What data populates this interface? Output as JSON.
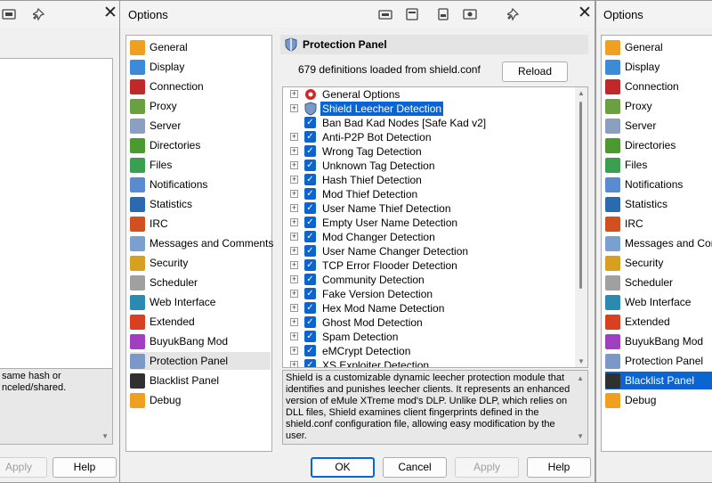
{
  "left_window": {
    "desc_lines": [
      "same hash or",
      "nceled/shared."
    ],
    "apply_label": "Apply",
    "help_label": "Help"
  },
  "main_window": {
    "title": "Options",
    "nav_items": [
      {
        "label": "General",
        "icon": "general-icon",
        "color": "#f0a020"
      },
      {
        "label": "Display",
        "icon": "display-icon",
        "color": "#3c8ad8"
      },
      {
        "label": "Connection",
        "icon": "connection-icon",
        "color": "#c0282a"
      },
      {
        "label": "Proxy",
        "icon": "proxy-icon",
        "color": "#6aa040"
      },
      {
        "label": "Server",
        "icon": "server-icon",
        "color": "#8aa0c0"
      },
      {
        "label": "Directories",
        "icon": "directories-icon",
        "color": "#4a9a30"
      },
      {
        "label": "Files",
        "icon": "files-icon",
        "color": "#3aa050"
      },
      {
        "label": "Notifications",
        "icon": "notifications-icon",
        "color": "#5a8ad0"
      },
      {
        "label": "Statistics",
        "icon": "statistics-icon",
        "color": "#2a6ab0"
      },
      {
        "label": "IRC",
        "icon": "irc-icon",
        "color": "#d05020"
      },
      {
        "label": "Messages and Comments",
        "icon": "messages-icon",
        "color": "#7aa0d0"
      },
      {
        "label": "Security",
        "icon": "security-icon",
        "color": "#d8a020"
      },
      {
        "label": "Scheduler",
        "icon": "scheduler-icon",
        "color": "#a0a0a0"
      },
      {
        "label": "Web Interface",
        "icon": "web-interface-icon",
        "color": "#2a8ab0"
      },
      {
        "label": "Extended",
        "icon": "extended-icon",
        "color": "#d84020"
      },
      {
        "label": "BuyukBang Mod",
        "icon": "buyukbang-icon",
        "color": "#a040c0"
      },
      {
        "label": "Protection Panel",
        "icon": "protection-icon",
        "color": "#7a98c8"
      },
      {
        "label": "Blacklist Panel",
        "icon": "blacklist-icon",
        "color": "#303030"
      },
      {
        "label": "Debug",
        "icon": "debug-icon",
        "color": "#f0a020"
      }
    ],
    "panel_title": "Protection Panel",
    "defs_text": "679 definitions loaded from shield.conf",
    "reload_label": "Reload",
    "tree_items": [
      {
        "label": "General Options",
        "kind": "gear"
      },
      {
        "label": "Shield Leecher Detection",
        "kind": "shield",
        "highlighted": true
      },
      {
        "label": "Ban Bad Kad Nodes [Safe Kad v2]",
        "kind": "check",
        "leaf": true
      },
      {
        "label": "Anti-P2P Bot Detection",
        "kind": "check"
      },
      {
        "label": "Wrong Tag Detection",
        "kind": "check"
      },
      {
        "label": "Unknown Tag Detection",
        "kind": "check"
      },
      {
        "label": "Hash Thief Detection",
        "kind": "check"
      },
      {
        "label": "Mod Thief Detection",
        "kind": "check"
      },
      {
        "label": "User Name Thief Detection",
        "kind": "check"
      },
      {
        "label": "Empty User Name Detection",
        "kind": "check"
      },
      {
        "label": "Mod Changer Detection",
        "kind": "check"
      },
      {
        "label": "User Name Changer Detection",
        "kind": "check"
      },
      {
        "label": "TCP Error Flooder Detection",
        "kind": "check"
      },
      {
        "label": "Community Detection",
        "kind": "check"
      },
      {
        "label": "Fake Version Detection",
        "kind": "check"
      },
      {
        "label": "Hex Mod Name Detection",
        "kind": "check"
      },
      {
        "label": "Ghost Mod Detection",
        "kind": "check"
      },
      {
        "label": "Spam Detection",
        "kind": "check"
      },
      {
        "label": "eMCrypt Detection",
        "kind": "check"
      },
      {
        "label": "XS Exploiter Detection",
        "kind": "check"
      }
    ],
    "description": "Shield is a customizable dynamic leecher protection module that identifies and punishes leecher clients. It represents an enhanced version of eMule XTreme mod's DLP. Unlike DLP, which relies on DLL files, Shield examines client fingerprints defined in the shield.conf configuration file, allowing easy modification by the user.",
    "buttons": {
      "ok": "OK",
      "cancel": "Cancel",
      "apply": "Apply",
      "help": "Help"
    }
  },
  "right_window": {
    "title": "Options"
  }
}
